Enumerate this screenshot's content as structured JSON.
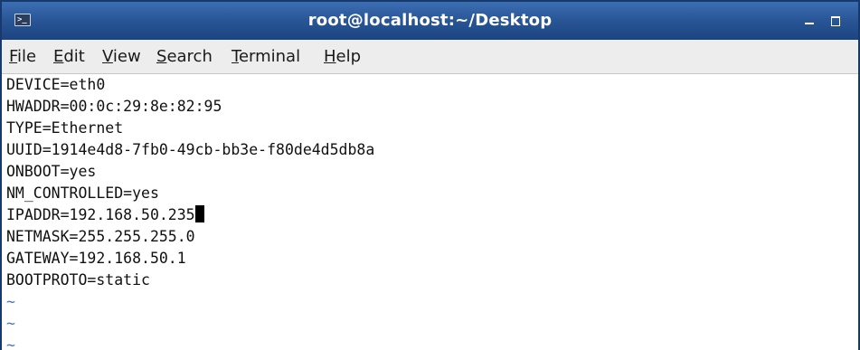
{
  "window": {
    "title": "root@localhost:~/Desktop"
  },
  "icons": {
    "app": "terminal-icon",
    "minimize": "minimize-icon",
    "maximize": "maximize-icon"
  },
  "menubar": {
    "items": [
      {
        "underline": "F",
        "rest": "ile"
      },
      {
        "underline": "E",
        "rest": "dit"
      },
      {
        "underline": "V",
        "rest": "iew"
      },
      {
        "underline": "S",
        "rest": "earch"
      },
      {
        "underline": "T",
        "rest": "erminal"
      },
      {
        "underline": "H",
        "rest": "elp"
      }
    ]
  },
  "terminal": {
    "lines": [
      "DEVICE=eth0",
      "HWADDR=00:0c:29:8e:82:95",
      "TYPE=Ethernet",
      "UUID=1914e4d8-7fb0-49cb-bb3e-f80de4d5db8a",
      "ONBOOT=yes",
      "NM_CONTROLLED=yes",
      "IPADDR=192.168.50.235",
      "NETMASK=255.255.255.0",
      "GATEWAY=192.168.50.1",
      "BOOTPROTO=static"
    ],
    "empty_lines": [
      "~",
      "~",
      "~"
    ]
  },
  "colors": {
    "titlebar": "#2a5798",
    "menubar": "#ededed",
    "tilde": "#4a6fd0",
    "text": "#111111"
  }
}
